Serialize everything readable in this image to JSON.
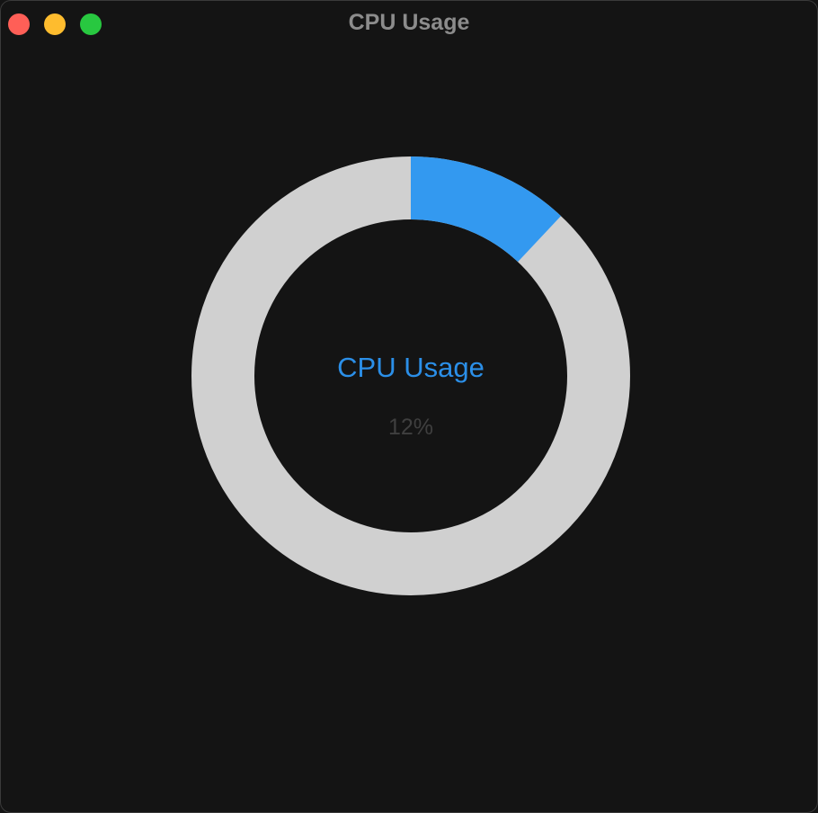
{
  "window": {
    "title": "CPU Usage",
    "controls": {
      "close_color": "#ff5f57",
      "minimize_color": "#febc2e",
      "zoom_color": "#28c840"
    }
  },
  "gauge": {
    "label": "CPU Usage",
    "value_text": "12%",
    "value_fraction": 0.12,
    "filled_color": "#3399f0",
    "track_color": "#d0d0d0",
    "label_color": "#2b8fe8",
    "value_color": "#3f3f3f"
  }
}
